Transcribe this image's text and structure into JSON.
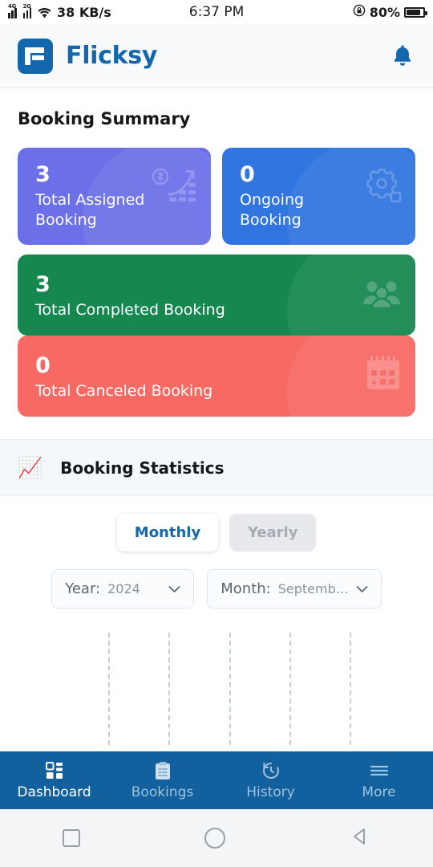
{
  "status_bar": {
    "sim1_label": "4G",
    "sim2_label": "2G",
    "network_speed": "38 KB/s",
    "time": "6:37 PM",
    "battery_percent": "80%",
    "rotation_lock_icon": "rotation-lock-icon",
    "wifi_icon": "wifi-icon",
    "battery_icon": "battery-icon"
  },
  "header": {
    "brand": "Flicksy",
    "logo_icon": "flicksy-logo-icon",
    "notification_icon": "bell-icon",
    "brand_color": "#1267ad"
  },
  "summary": {
    "title": "Booking Summary",
    "cards": [
      {
        "count": "3",
        "label": "Total Assigned Booking",
        "color": "#6c70e8",
        "icon": "growth-chart-dollar-icon"
      },
      {
        "count": "0",
        "label": "Ongoing Booking",
        "color": "#3075e0",
        "icon": "gear-icon"
      },
      {
        "count": "3",
        "label": "Total Completed Booking",
        "color": "#16874f",
        "icon": "people-group-icon"
      },
      {
        "count": "0",
        "label": "Total Canceled Booking",
        "color": "#f76a64",
        "icon": "calendar-icon"
      }
    ]
  },
  "statistics": {
    "title": "Booking Statistics",
    "title_icon": "chart-increasing-with-yen-icon",
    "period_tabs": [
      {
        "label": "Monthly",
        "selected": true
      },
      {
        "label": "Yearly",
        "selected": false
      }
    ],
    "filters": [
      {
        "label": "Year:",
        "value": "2024",
        "chevron": "chevron-down-icon"
      },
      {
        "label": "Month:",
        "value": "Septemb…",
        "chevron": "chevron-down-icon"
      }
    ]
  },
  "chart_data": {
    "type": "bar",
    "title": "Booking Statistics",
    "categories": [],
    "values": [],
    "series": [],
    "xlabel": "",
    "ylabel": "",
    "grid": true,
    "gridlines_x": [
      135,
      210,
      286,
      361,
      436
    ],
    "legend_position": "none",
    "note": "Chart plot area is empty (no bars rendered); only vertical dashed gridlines visible"
  },
  "bottom_nav": {
    "items": [
      {
        "label": "Dashboard",
        "icon": "dashboard-grid-icon",
        "active": true
      },
      {
        "label": "Bookings",
        "icon": "clipboard-list-icon",
        "active": false
      },
      {
        "label": "History",
        "icon": "clock-history-icon",
        "active": false
      },
      {
        "label": "More",
        "icon": "hamburger-menu-icon",
        "active": false
      }
    ],
    "background": "#12619e"
  },
  "system_nav": {
    "recents_icon": "square-recents-icon",
    "home_icon": "circle-home-icon",
    "back_icon": "triangle-back-icon"
  }
}
